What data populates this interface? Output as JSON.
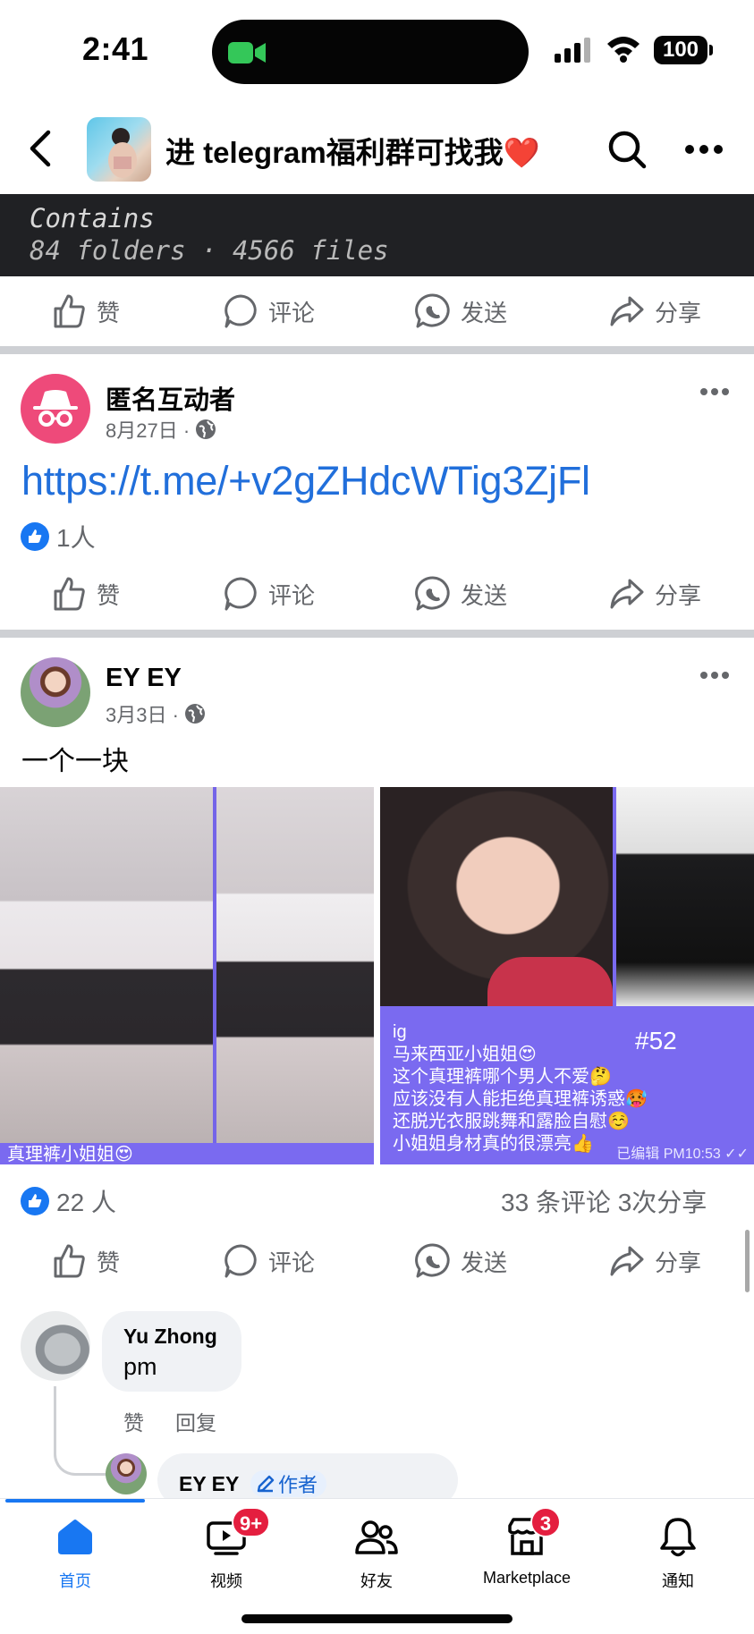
{
  "status_bar": {
    "time": "2:41",
    "battery": "100"
  },
  "header": {
    "title": "进 telegram福利群可找我",
    "title_emoji": "❤️"
  },
  "preview": {
    "line1": "Contains",
    "line2": "84 folders · 4566 files"
  },
  "actions": {
    "like": "赞",
    "comment": "评论",
    "send": "发送",
    "share": "分享"
  },
  "post1": {
    "author": "匿名互动者",
    "date": "8月27日 ·",
    "link": "https://t.me/+v2gZHdcWTig3ZjFl",
    "reactions": "1人"
  },
  "post2": {
    "author": "EY EY",
    "date": "3月3日 ·",
    "text": "一个一块",
    "media": {
      "left_strip": "真理裤小姐姐😍",
      "caption_lines": [
        "ig",
        "马来西亚小姐姐😍",
        "这个真理裤哪个男人不爱🤔",
        "应该没有人能拒绝真理裤诱惑🥵",
        "还脱光衣服跳舞和露脸自慰☺️",
        "小姐姐身材真的很漂亮👍"
      ],
      "tag": "#52",
      "edited": "已编辑 PM10:53 ✓✓"
    },
    "reactions": "22 人",
    "stats": "33 条评论   3次分享"
  },
  "comments": [
    {
      "author": "Yu Zhong",
      "text": "pm",
      "like": "赞",
      "reply": "回复"
    },
    {
      "author": "EY EY",
      "badge": "作者"
    }
  ],
  "tabbar": {
    "tabs": [
      {
        "label": "首页",
        "icon": "home-icon",
        "active": true
      },
      {
        "label": "视频",
        "icon": "video-icon",
        "badge": "9+"
      },
      {
        "label": "好友",
        "icon": "friends-icon"
      },
      {
        "label": "Marketplace",
        "icon": "marketplace-icon",
        "badge": "3"
      },
      {
        "label": "通知",
        "icon": "bell-icon"
      }
    ]
  },
  "colors": {
    "accent": "#1877f2",
    "link": "#216fdb",
    "badge": "#e41e3f",
    "muted": "#65676b"
  }
}
